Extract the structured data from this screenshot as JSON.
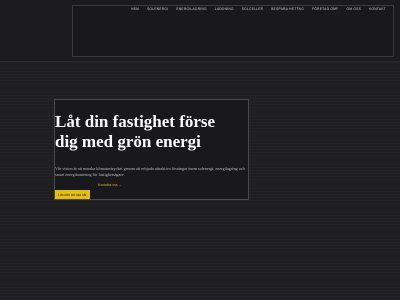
{
  "nav": {
    "items": [
      {
        "label": "HEM"
      },
      {
        "label": "SOLENERGI"
      },
      {
        "label": "ENERGILAGRING"
      },
      {
        "label": "LADDNING"
      },
      {
        "label": "SOLCELLER"
      },
      {
        "label": "BESPARA HETTNG"
      },
      {
        "label": "FÖRETAG OMF"
      },
      {
        "label": "OM OSS"
      },
      {
        "label": "KONTAKT"
      }
    ]
  },
  "hero": {
    "title_line1": "Låt din fastighet förse",
    "title_line2": "dig med grön energi",
    "description": "Vår vision är att minska klimatavtrycket genom att erbjuda attraktiva lösningar inom solenergi, energilagring och smart energihantering för fastighetsägare.",
    "link_label": "Kontakta oss →",
    "cta_label": "Läs mer om oss här"
  },
  "colors": {
    "background": "#1f1f22",
    "accent": "#e4bd16",
    "text": "#ffffff"
  }
}
